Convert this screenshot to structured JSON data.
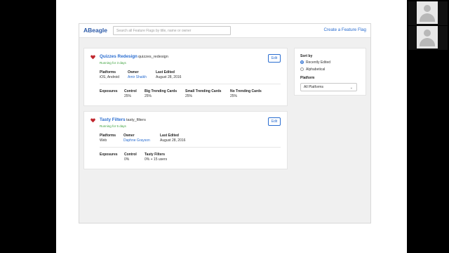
{
  "header": {
    "logo": "ABeagle",
    "search_placeholder": "Search all Feature Flags by title, name or owner",
    "create_link": "Create a Feature Flag"
  },
  "labels": {
    "platforms": "Platforms",
    "owner": "Owner",
    "last_edited": "Last Edited",
    "exposures": "Exposures",
    "edit": "Edit"
  },
  "flags": [
    {
      "name": "Quizzes Redesign",
      "key": "quizzes_redesign",
      "status": "Running for 3 days",
      "platforms": "iOS, Android",
      "owner": "Amir Shaikh",
      "last_edited": "August 28, 2016",
      "variants": [
        {
          "name": "Control",
          "value": "25%"
        },
        {
          "name": "Big Trending Cards",
          "value": "25%"
        },
        {
          "name": "Small Trending Cards",
          "value": "25%"
        },
        {
          "name": "No Trending Cards",
          "value": "25%"
        }
      ]
    },
    {
      "name": "Tasty Filters",
      "key": "tasty_filters",
      "status": "Running for 5 days",
      "platforms": "Web",
      "owner": "Daphne Grayson",
      "last_edited": "August 28, 2016",
      "variants": [
        {
          "name": "Control",
          "value": "0%"
        },
        {
          "name": "Tasty Filters",
          "value": "0% + 15 users"
        }
      ]
    }
  ],
  "sidebar": {
    "sort_by": "Sort by",
    "options": [
      "Recently Edited",
      "Alphabetical"
    ],
    "selected_option": "Recently Edited",
    "platform_label": "Platform",
    "platform_value": "All Platforms"
  },
  "colors": {
    "accent": "#2a6dd0",
    "running": "#3aa03a",
    "heart": "#c0262d"
  },
  "icons": [
    "heart-icon",
    "chevron-down-icon",
    "user-avatar-icon"
  ]
}
